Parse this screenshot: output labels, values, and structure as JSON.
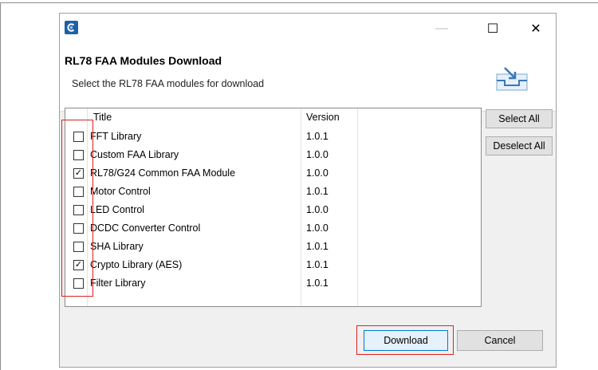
{
  "window": {
    "minimize": "—",
    "maximize": "☐",
    "close": "✕",
    "icon": "app-icon"
  },
  "header": {
    "title": "RL78 FAA Modules Download",
    "subtitle": "Select the RL78 FAA modules for download",
    "graphic": "download-tray-icon"
  },
  "table": {
    "columns": [
      "Title",
      "Version"
    ],
    "rows": [
      {
        "title": "FFT Library",
        "version": "1.0.1",
        "checked": false,
        "mark": ""
      },
      {
        "title": "Custom FAA Library",
        "version": "1.0.0",
        "checked": false,
        "mark": ""
      },
      {
        "title": "RL78/G24 Common FAA Module",
        "version": "1.0.0",
        "checked": true,
        "mark": "✓"
      },
      {
        "title": "Motor Control",
        "version": "1.0.1",
        "checked": false,
        "mark": ""
      },
      {
        "title": "LED Control",
        "version": "1.0.0",
        "checked": false,
        "mark": ""
      },
      {
        "title": "DCDC Converter Control",
        "version": "1.0.0",
        "checked": false,
        "mark": ""
      },
      {
        "title": "SHA Library",
        "version": "1.0.1",
        "checked": false,
        "mark": ""
      },
      {
        "title": "Crypto Library (AES)",
        "version": "1.0.1",
        "checked": true,
        "mark": "✓"
      },
      {
        "title": "Filter Library",
        "version": "1.0.1",
        "checked": false,
        "mark": ""
      }
    ]
  },
  "side_buttons": {
    "select_all": "Select All",
    "deselect_all": "Deselect All"
  },
  "footer": {
    "download": "Download",
    "cancel": "Cancel"
  },
  "colors": {
    "highlight": "#e02020",
    "default_button_border": "#0078d7"
  }
}
